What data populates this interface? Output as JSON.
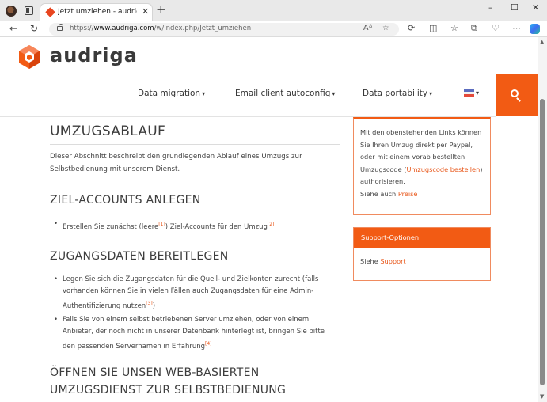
{
  "browser": {
    "tab_title": "Jetzt umziehen - audriga - data",
    "tab_close": "✕",
    "new_tab": "+",
    "window_controls": [
      "–",
      "☐",
      "✕"
    ],
    "url_prefix": "https://",
    "url_host": "www.audriga.com",
    "url_path": "/w/index.php/Jetzt_umziehen",
    "nav": {
      "back": "←",
      "reload": "↻"
    }
  },
  "site": {
    "logo_text": "audriga",
    "brand_color": "#f25b14",
    "nav": [
      {
        "label": "Data migration"
      },
      {
        "label": "Email client autoconfig"
      },
      {
        "label": "Data portability"
      }
    ],
    "caret": "▾",
    "language_flag": "de-flag-icon",
    "search_icon": "search-icon"
  },
  "content": {
    "heading_ablauf": "UMZUGSABLAUF",
    "intro": "Dieser Abschnitt beschreibt den grundlegenden Ablauf eines Umzugs zur Selbstbedienung mit unserem Dienst.",
    "heading_ziel": "ZIEL-ACCOUNTS ANLEGEN",
    "ziel_items": [
      {
        "before": "Erstellen Sie zunächst (leere",
        "ref1": "[1]",
        "middle": ") Ziel-Accounts für den Umzug",
        "ref2": "[2]"
      }
    ],
    "heading_zugang": "ZUGANGSDATEN BEREITLEGEN",
    "zugang_items": [
      {
        "text": "Legen Sie sich die Zugangsdaten für die Quell- und Zielkonten zurecht (falls vorhanden können Sie in vielen Fällen auch Zugangsdaten für eine Admin-Authentifizierung nutzen",
        "ref": "[3]",
        "after": ")"
      },
      {
        "text": "Falls Sie von einem selbst betriebenen Server umziehen, oder von einem Anbieter, der noch nicht in unserer Datenbank hinterlegt ist, bringen Sie bitte den passenden Servernamen in Erfahrung",
        "ref": "[4]",
        "after": ""
      }
    ],
    "heading_open": "ÖFFNEN SIE UNSEN WEB-BASIERTEN UMZUGSDIENST ZUR SELBSTBEDIENUNG"
  },
  "sidebar": {
    "box1_text_before": "Mit den obenstehenden Links können Sie Ihren Umzug direkt per Paypal, oder mit einem vorab bestellten Umzugscode (",
    "box1_link": "Umzugscode bestellen",
    "box1_text_after": ") authorisieren.",
    "box1_see": "Siehe auch ",
    "box1_see_link": "Preise",
    "box2_title": "Support-Optionen",
    "box2_see": "Siehe ",
    "box2_see_link": "Support"
  }
}
